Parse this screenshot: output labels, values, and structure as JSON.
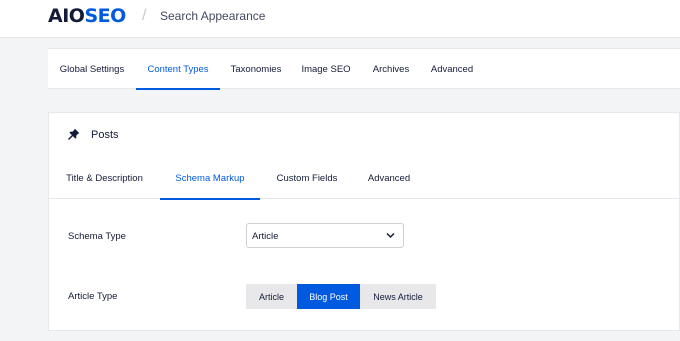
{
  "header": {
    "logo_primary": "AIO",
    "logo_accent": "SEO",
    "separator": "/",
    "page_title": "Search Appearance"
  },
  "main_tabs": [
    {
      "label": "Global Settings",
      "active": false
    },
    {
      "label": "Content Types",
      "active": true
    },
    {
      "label": "Taxonomies",
      "active": false
    },
    {
      "label": "Image SEO",
      "active": false
    },
    {
      "label": "Archives",
      "active": false
    },
    {
      "label": "Advanced",
      "active": false
    }
  ],
  "card": {
    "icon": "pin-icon",
    "title": "Posts",
    "sub_tabs": [
      {
        "label": "Title & Description",
        "active": false
      },
      {
        "label": "Schema Markup",
        "active": true
      },
      {
        "label": "Custom Fields",
        "active": false
      },
      {
        "label": "Advanced",
        "active": false
      }
    ],
    "schema_type": {
      "label": "Schema Type",
      "selected": "Article"
    },
    "article_type": {
      "label": "Article Type",
      "options": [
        {
          "label": "Article",
          "selected": false
        },
        {
          "label": "Blog Post",
          "selected": true
        },
        {
          "label": "News Article",
          "selected": false
        }
      ]
    }
  },
  "colors": {
    "accent": "#005ae0",
    "text": "#141b38",
    "background": "#f3f4f5",
    "segment_off": "#e8e8eb"
  }
}
